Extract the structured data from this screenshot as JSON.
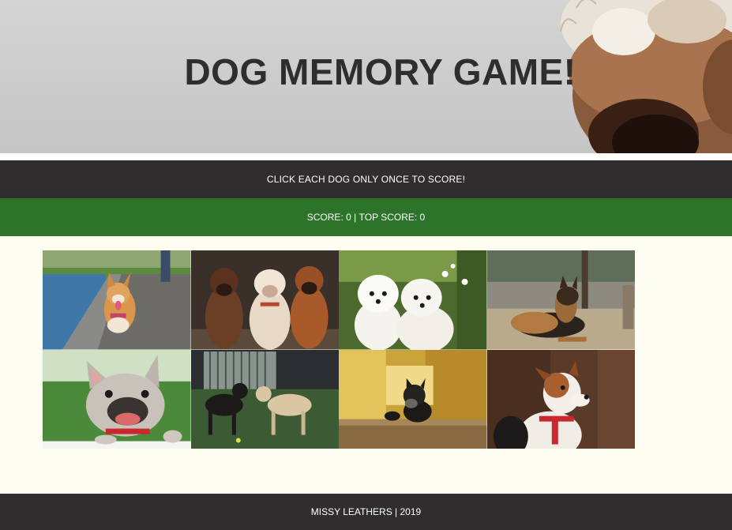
{
  "header": {
    "title": "DOG MEMORY GAME!"
  },
  "instructions": {
    "text": "CLICK EACH DOG ONLY ONCE TO SCORE!"
  },
  "scoreboard": {
    "score_label": "SCORE:",
    "score": "0",
    "separator": "|",
    "top_score_label": "TOP SCORE:",
    "top_score": "0"
  },
  "cards": [
    {
      "icon": "corgi-dog-image"
    },
    {
      "icon": "three-boxer-dogs-image"
    },
    {
      "icon": "two-white-puppies-image"
    },
    {
      "icon": "german-shepherd-image"
    },
    {
      "icon": "french-bulldog-image"
    },
    {
      "icon": "two-labradors-image"
    },
    {
      "icon": "schnauzer-dog-image"
    },
    {
      "icon": "jack-russell-image"
    }
  ],
  "footer": {
    "text": "MISSY LEATHERS | 2019"
  },
  "colors": {
    "page_background": "#fdfdf2",
    "dark_bar": "#302d2e",
    "score_bar": "#2b7429",
    "title_text": "#302d2d"
  }
}
